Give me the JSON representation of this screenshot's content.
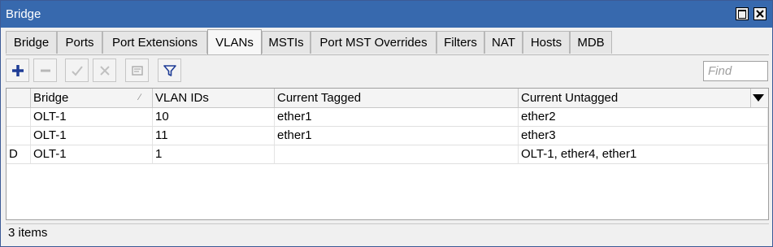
{
  "window": {
    "title": "Bridge"
  },
  "tabs": [
    {
      "label": "Bridge"
    },
    {
      "label": "Ports"
    },
    {
      "label": "Port Extensions"
    },
    {
      "label": "VLANs",
      "active": true
    },
    {
      "label": "MSTIs"
    },
    {
      "label": "Port MST Overrides"
    },
    {
      "label": "Filters"
    },
    {
      "label": "NAT"
    },
    {
      "label": "Hosts"
    },
    {
      "label": "MDB"
    }
  ],
  "toolbar": {
    "buttons": [
      "add-icon",
      "remove-icon",
      "enable-icon",
      "disable-icon",
      "comment-icon",
      "filter-icon"
    ],
    "accent": "#1e3c96"
  },
  "search": {
    "placeholder": "Find"
  },
  "table": {
    "columns": [
      "",
      "Bridge",
      "VLAN IDs",
      "Current Tagged",
      "Current Untagged"
    ],
    "rows": [
      {
        "flag": "",
        "bridge": "OLT-1",
        "vlan_ids": "10",
        "tagged": "ether1",
        "untagged": "ether2"
      },
      {
        "flag": "",
        "bridge": "OLT-1",
        "vlan_ids": "11",
        "tagged": "ether1",
        "untagged": "ether3"
      },
      {
        "flag": "D",
        "bridge": "OLT-1",
        "vlan_ids": "1",
        "tagged": "",
        "untagged": "OLT-1, ether4, ether1"
      }
    ]
  },
  "status": {
    "items": "3 items"
  }
}
